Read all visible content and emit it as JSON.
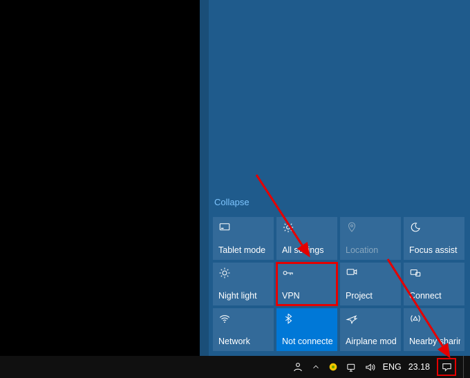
{
  "action_center": {
    "collapse_label": "Collapse",
    "tiles": [
      {
        "id": "tablet-mode",
        "label": "Tablet mode",
        "icon": "tablet-mode-icon",
        "state": "normal"
      },
      {
        "id": "all-settings",
        "label": "All settings",
        "icon": "gear-icon",
        "state": "normal"
      },
      {
        "id": "location",
        "label": "Location",
        "icon": "location-icon",
        "state": "disabled"
      },
      {
        "id": "focus-assist",
        "label": "Focus assist",
        "icon": "moon-icon",
        "state": "normal"
      },
      {
        "id": "night-light",
        "label": "Night light",
        "icon": "sun-icon",
        "state": "normal"
      },
      {
        "id": "vpn",
        "label": "VPN",
        "icon": "vpn-icon",
        "state": "highlighted"
      },
      {
        "id": "project",
        "label": "Project",
        "icon": "project-icon",
        "state": "normal"
      },
      {
        "id": "connect",
        "label": "Connect",
        "icon": "connect-icon",
        "state": "normal"
      },
      {
        "id": "network",
        "label": "Network",
        "icon": "wifi-icon",
        "state": "normal"
      },
      {
        "id": "bluetooth",
        "label": "Not connected",
        "icon": "bluetooth-icon",
        "state": "active"
      },
      {
        "id": "airplane-mode",
        "label": "Airplane mode",
        "icon": "airplane-icon",
        "state": "normal"
      },
      {
        "id": "nearby-sharing",
        "label": "Nearby sharing",
        "icon": "nearby-share-icon",
        "state": "normal"
      }
    ]
  },
  "taskbar": {
    "language": "ENG",
    "clock": "23.18"
  },
  "annotation": {
    "highlight_tile": "vpn",
    "highlight_tray": "action-center"
  },
  "colors": {
    "accent": "#0078d7",
    "tile_bg": "#336a99",
    "panel_bg": "#1f5b8c",
    "highlight": "#e40000"
  }
}
